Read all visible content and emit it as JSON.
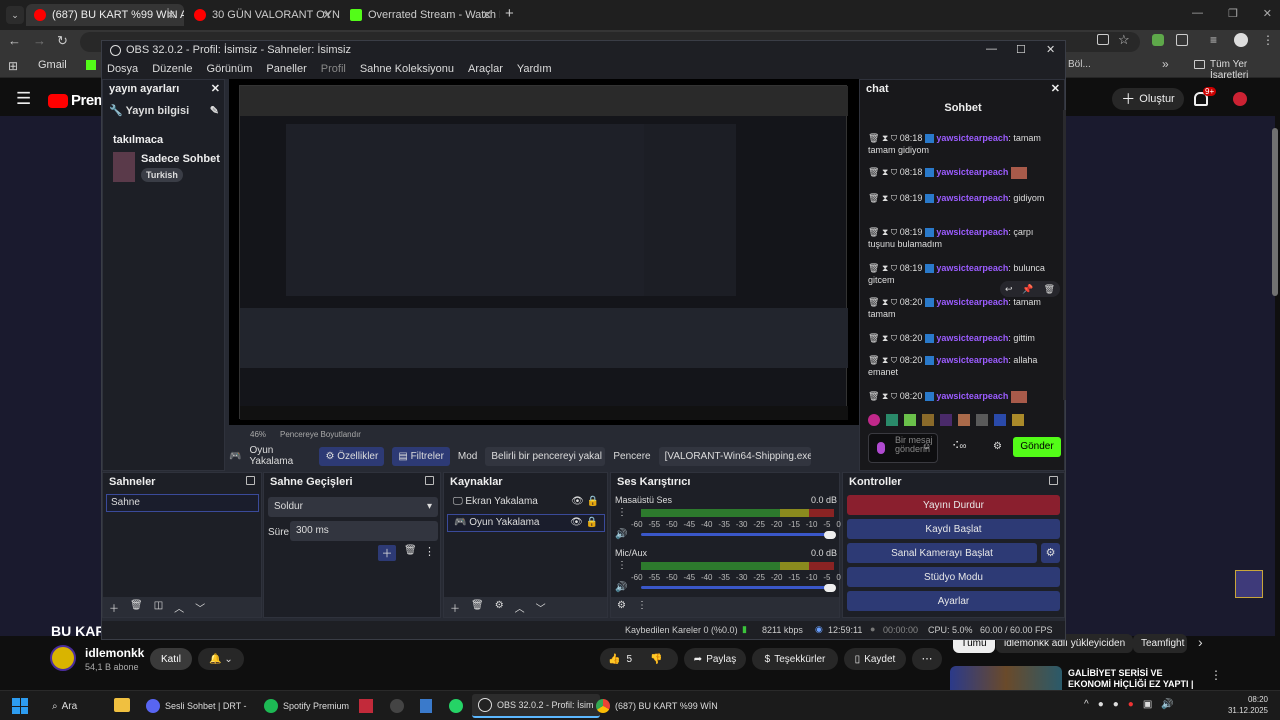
{
  "browser": {
    "tabs": [
      {
        "title": "(687) BU KART %99 WİN ALDIRI",
        "color": "#ff0000"
      },
      {
        "title": "30 GÜN VALORANT OYNAMAY",
        "color": "#ff0000"
      },
      {
        "title": "Overrated Stream - Watch Live",
        "color": "#53fc18"
      }
    ],
    "bookmarks": {
      "gmail": "Gmail",
      "bol": "Böl...",
      "all": "Tüm Yer İşaretleri"
    }
  },
  "youtube": {
    "logo": "Premi",
    "create_label": "Oluştur",
    "notif_badge": "9+",
    "video_title": "BU KART",
    "channel_name": "idlemonkk",
    "subs": "54,1 B abone",
    "join_label": "Katıl",
    "like_count": "5",
    "share_label": "Paylaş",
    "thanks_label": "Teşekkürler",
    "save_label": "Kaydet",
    "chips": [
      "Tümü",
      "idlemonkk adlı yükleyiciden",
      "Teamfight"
    ],
    "rec_title": "GALİBİYET SERİSİ VE EKONOMİ HİÇLİĞİ EZ YAPTI | HOLYTHOT"
  },
  "obs": {
    "title": "OBS 32.0.2 - Profil: İsimsiz - Sahneler: İsimsiz",
    "menu": [
      "Dosya",
      "Düzenle",
      "Görünüm",
      "Paneller",
      "Profil",
      "Sahne Koleksiyonu",
      "Araçlar",
      "Yardım"
    ],
    "stream_settings": {
      "header": "yayın ayarları",
      "info": "Yayın bilgisi",
      "title_label": "takılmaca",
      "category": "Sadece Sohbet",
      "tag": "Turkish"
    },
    "preview_zoom": "46%",
    "fit_label": "Pencereye Boyutlandır",
    "source_bar": {
      "name": "Oyun Yakalama",
      "props": "Özellikler",
      "filters": "Filtreler",
      "mode_label": "Mod",
      "mode_value": "Belirli bir pencereyi yakal",
      "window_label": "Pencere",
      "window_value": "[VALORANT-Win64-Shipping.exe"
    },
    "scenes": {
      "header": "Sahneler",
      "items": [
        "Sahne"
      ]
    },
    "transitions": {
      "header": "Sahne Geçişleri",
      "type": "Soldur",
      "duration_label": "Süre",
      "duration": "300 ms"
    },
    "sources": {
      "header": "Kaynaklar",
      "items": [
        "Ekran Yakalama",
        "Oyun Yakalama"
      ]
    },
    "mixer": {
      "header": "Ses Karıştırıcı",
      "channels": [
        {
          "name": "Masaüstü Ses",
          "db": "0.0 dB",
          "level": 0.72
        },
        {
          "name": "Mic/Aux",
          "db": "0.0 dB",
          "level": 0.25
        }
      ],
      "scale": [
        "-60",
        "-55",
        "-50",
        "-45",
        "-40",
        "-35",
        "-30",
        "-25",
        "-20",
        "-15",
        "-10",
        "-5",
        "0"
      ]
    },
    "controls": {
      "header": "Kontroller",
      "buttons": [
        "Yayını Durdur",
        "Kaydı Başlat",
        "Sanal Kamerayı Başlat",
        "Stüdyo Modu",
        "Ayarlar"
      ]
    },
    "status": {
      "dropped": "Kaybedilen Kareler 0 (%0.0)",
      "bitrate": "8211 kbps",
      "stream_time": "12:59:11",
      "rec_time": "00:00:00",
      "cpu": "CPU: 5.0%",
      "fps": "60.00 / 60.00 FPS"
    },
    "chat": {
      "dock_title": "chat",
      "header": "Sohbet",
      "messages": [
        {
          "time": "08:18",
          "user": "yawsictearpeach",
          "text": ": tamam tamam gidiyom"
        },
        {
          "time": "08:18",
          "user": "yawsictearpeach",
          "text": ""
        },
        {
          "time": "08:19",
          "user": "yawsictearpeach",
          "text": ": gidiyom"
        },
        {
          "time": "08:19",
          "user": "yawsictearpeach",
          "text": ": çarpı tuşunu bulamadım"
        },
        {
          "time": "08:19",
          "user": "yawsictearpeach",
          "text": ": bulunca gitcem"
        },
        {
          "time": "08:20",
          "user": "yawsictearpeach",
          "text": ": tamam tamam"
        },
        {
          "time": "08:20",
          "user": "yawsictearpeach",
          "text": ": gittim"
        },
        {
          "time": "08:20",
          "user": "yawsictearpeach",
          "text": ": allaha emanet"
        },
        {
          "time": "08:20",
          "user": "yawsictearpeach",
          "text": ""
        }
      ],
      "input_placeholder": "Bir mesaj gönderin",
      "send_label": "Gönder"
    }
  },
  "taskbar": {
    "search": "Ara",
    "items": [
      "Sesli Sohbet | DRT -",
      "Spotify Premium",
      "OBS 32.0.2 - Profil: İsim",
      "(687) BU KART %99 WİN"
    ],
    "time": "08:20",
    "date": "31.12.2025"
  }
}
